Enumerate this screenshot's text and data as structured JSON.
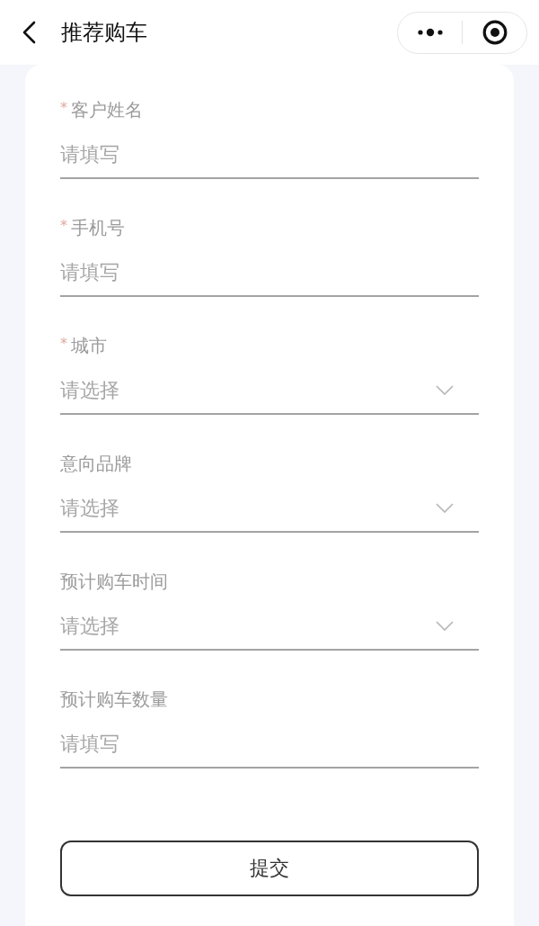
{
  "header": {
    "title": "推荐购车"
  },
  "form": {
    "fields": [
      {
        "label": "客户姓名",
        "required": true,
        "kind": "input",
        "placeholder": "请填写"
      },
      {
        "label": "手机号",
        "required": true,
        "kind": "input",
        "placeholder": "请填写"
      },
      {
        "label": "城市",
        "required": true,
        "kind": "select",
        "placeholder": "请选择"
      },
      {
        "label": "意向品牌",
        "required": false,
        "kind": "select",
        "placeholder": "请选择"
      },
      {
        "label": "预计购车时间",
        "required": false,
        "kind": "select",
        "placeholder": "请选择"
      },
      {
        "label": "预计购车数量",
        "required": false,
        "kind": "input",
        "placeholder": "请填写"
      }
    ],
    "required_mark": "*",
    "submit": "提交"
  }
}
